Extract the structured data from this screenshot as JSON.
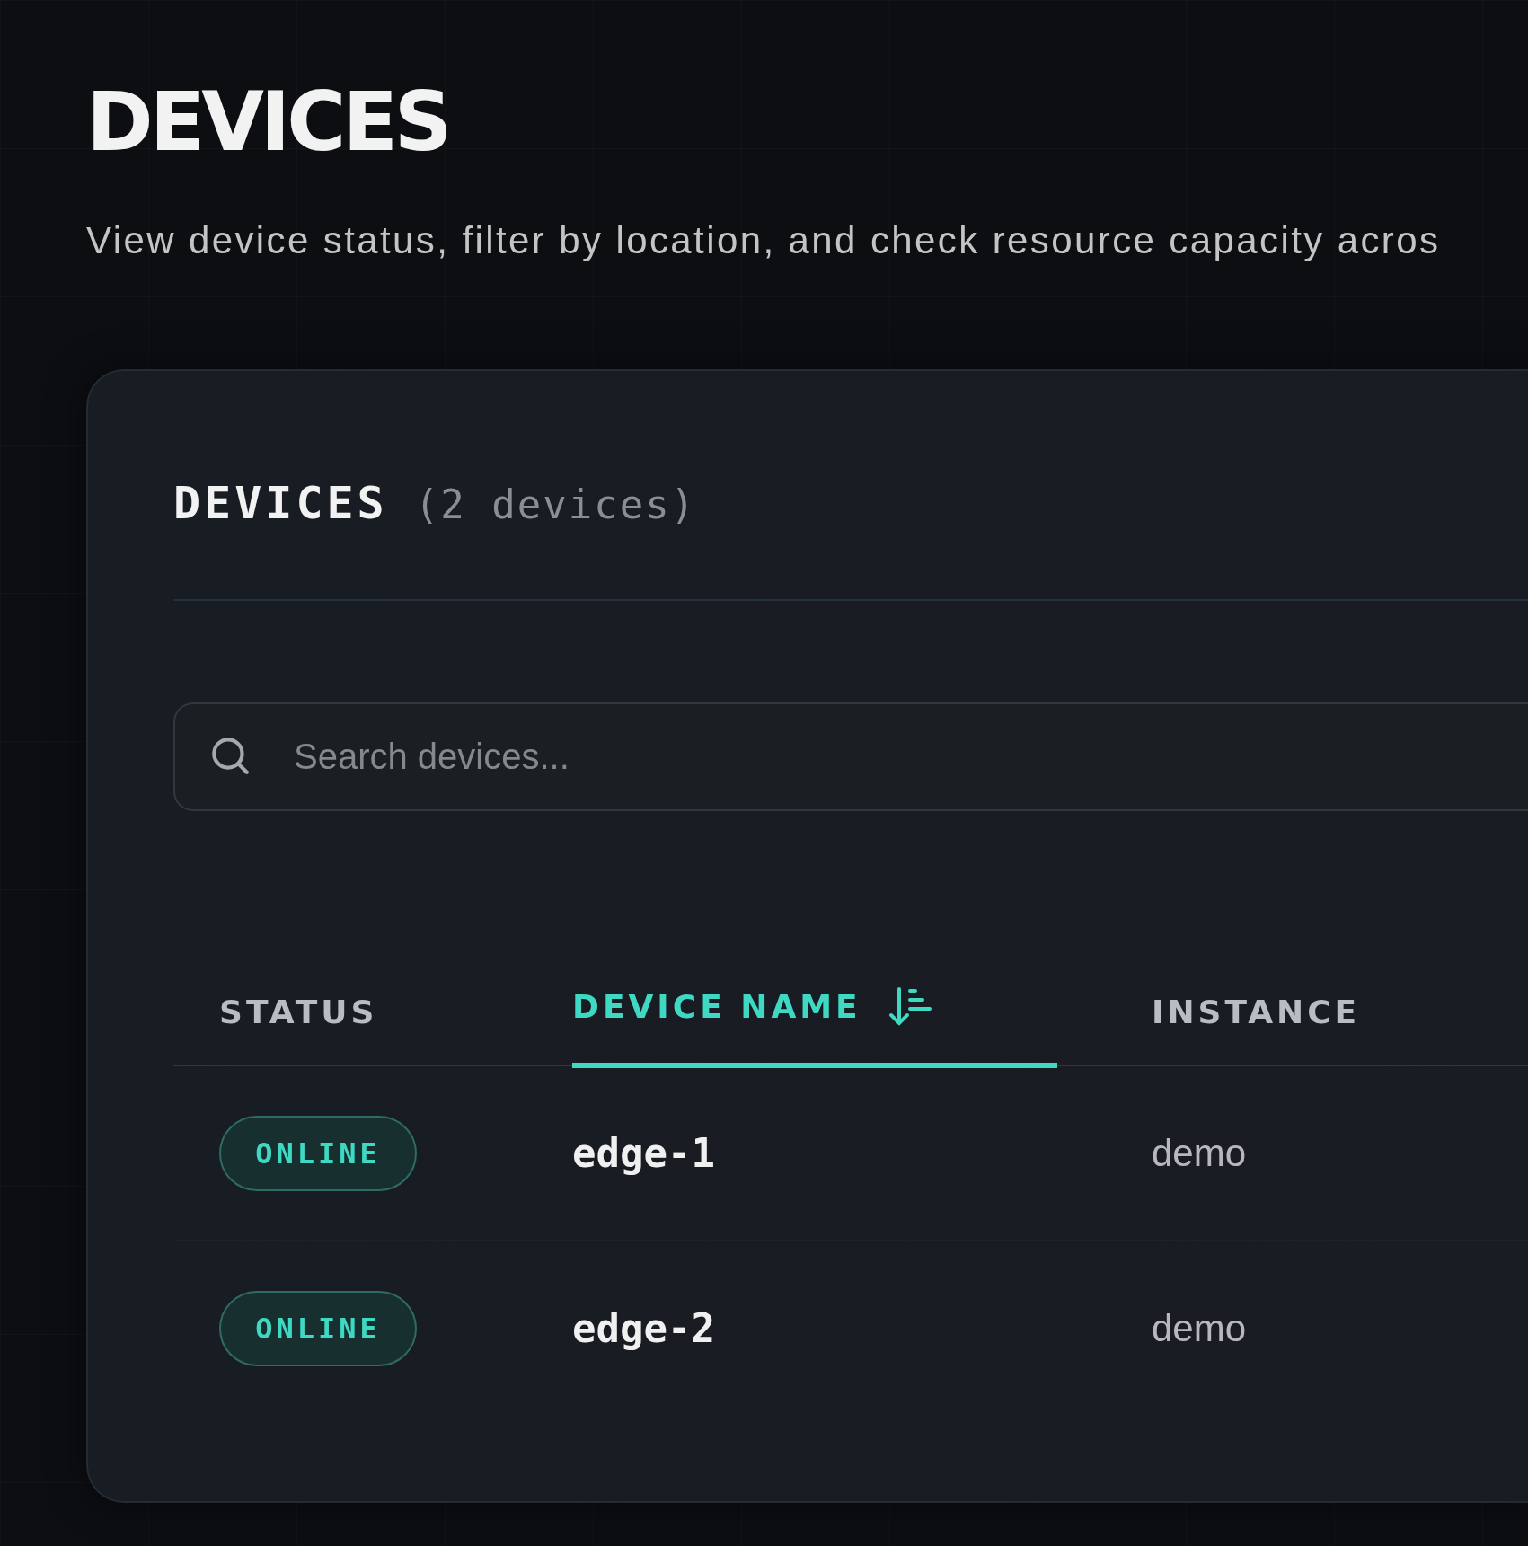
{
  "page": {
    "title": "DEVICES",
    "subtitle": "View device status, filter by location, and check resource capacity acros"
  },
  "card": {
    "title": "DEVICES",
    "count": "(2 devices)"
  },
  "search": {
    "placeholder": "Search devices..."
  },
  "table": {
    "columns": [
      {
        "label": "STATUS",
        "selected": false
      },
      {
        "label": "DEVICE NAME",
        "selected": true
      },
      {
        "label": "INSTANCE",
        "selected": false
      }
    ],
    "rows": [
      {
        "status": "ONLINE",
        "name": "edge-1",
        "instance": "demo"
      },
      {
        "status": "ONLINE",
        "name": "edge-2",
        "instance": "demo"
      }
    ]
  }
}
